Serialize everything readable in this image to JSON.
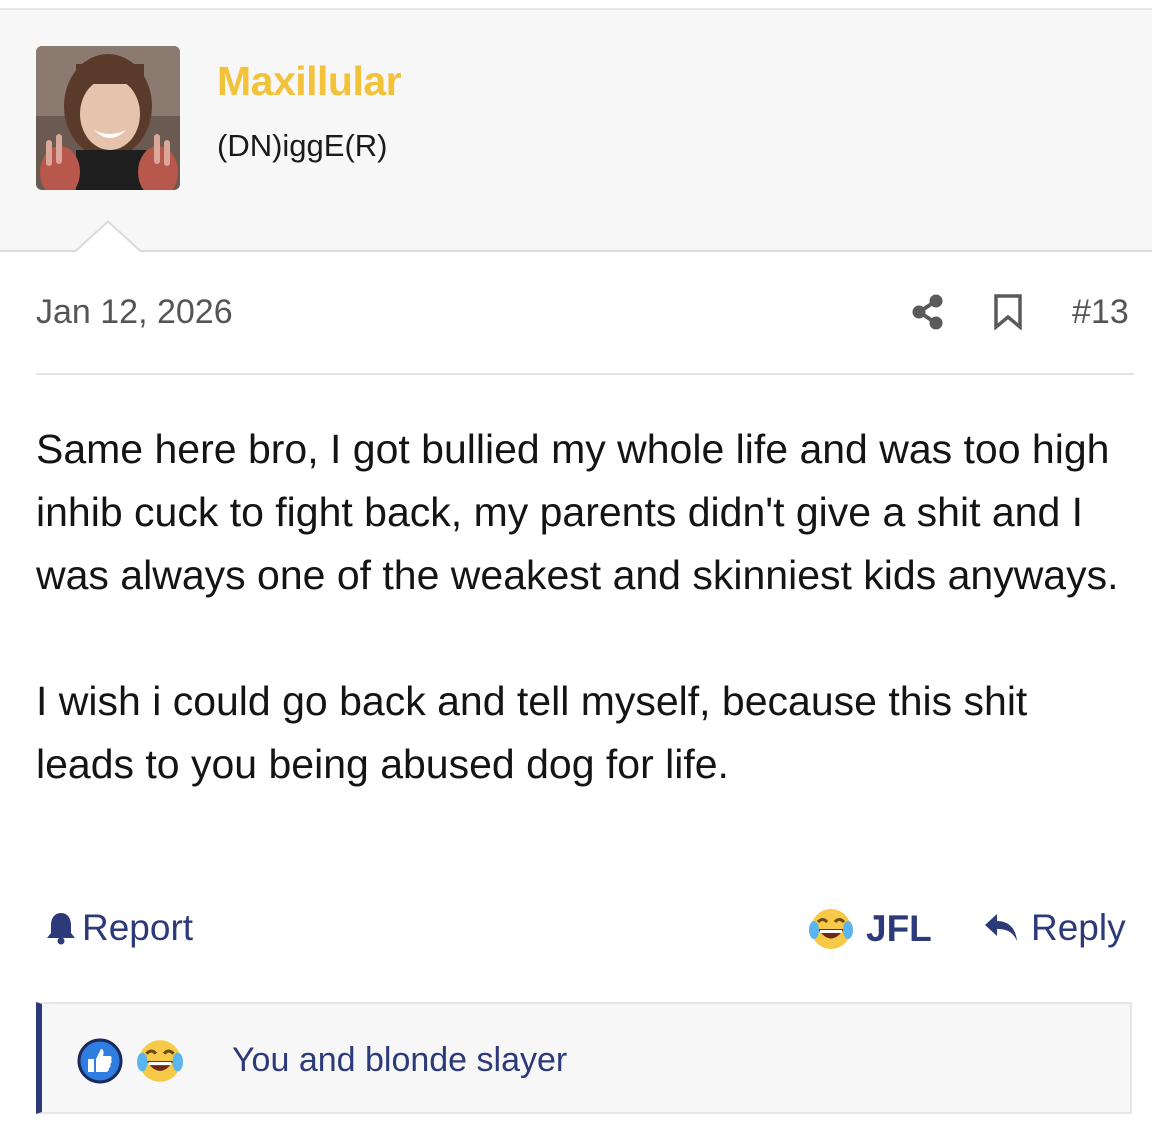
{
  "user": {
    "name": "Maxillular",
    "title": "(DN)iggE(R)",
    "avatar_icon": "user-avatar-photo"
  },
  "post": {
    "date": "Jan 12, 2026",
    "number": "#13",
    "paragraphs": [
      "Same here bro, I got bullied my whole life and was too high inhib cuck to fight back, my parents didn't give a shit and I was always one of the weakest and skinniest kids anyways.",
      "I wish i could go back and tell myself, because this shit leads to you being abused dog for life."
    ]
  },
  "actions": {
    "report_label": "Report",
    "jfl_label": "JFL",
    "reply_label": "Reply"
  },
  "reactions": {
    "summary": "You and blonde slayer",
    "icons": [
      "like-icon",
      "laugh-cry-icon"
    ]
  },
  "colors": {
    "username": "#f2c23a",
    "accent": "#2d3a7a",
    "meta_text": "#555555",
    "body_text": "#141414"
  }
}
